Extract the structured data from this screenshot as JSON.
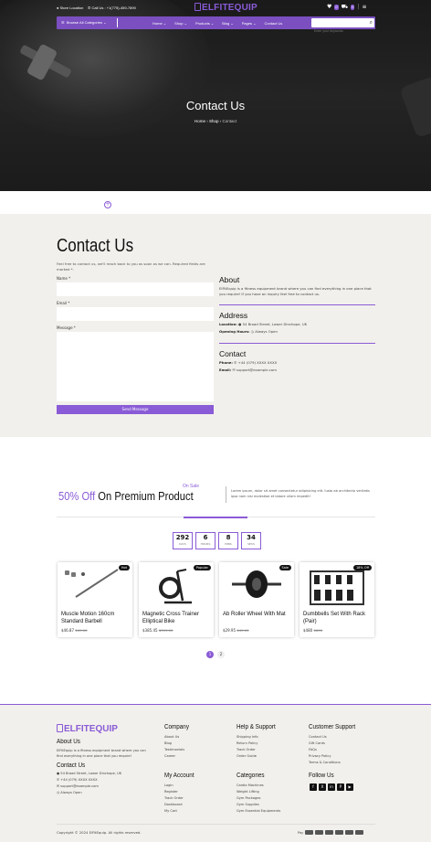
{
  "brand": {
    "name": "ELFITEQUIP",
    "accent": "#8a5bd6",
    "nav_bg": "#7b4fc0"
  },
  "topbar": {
    "store": "Store Location",
    "call": "Call Us : +1(775)-459-7890",
    "wishlist_count": "0",
    "cart_count": "0"
  },
  "nav": {
    "categories": "Browse All Categories",
    "items": [
      "Home",
      "Shop",
      "Products",
      "Blog",
      "Pages",
      "Contact Us"
    ],
    "search_placeholder": "Enter your keywords"
  },
  "hero": {
    "title": "Contact Us",
    "crumb_home": "Home",
    "crumb_shop": "Shop",
    "crumb_current": "Contact"
  },
  "contact": {
    "title": "Contact Us",
    "intro": "Feel free to contact us, we'll reach back to you as soon as we can. Required fields are marked *.",
    "name_label": "Name *",
    "email_label": "Email *",
    "message_label": "Message *",
    "send": "Send Message",
    "about_title": "About",
    "about_text": "ElFitEquip is a fitness equipment brand where you can find everything in one place that you require! If you have an inquiry feel free to contact us.",
    "address_title": "Address",
    "location_label": "Location:",
    "location_value": "54 Broad Street, Lower Dinchope, UK",
    "hours_label": "Opening Hours:",
    "hours_value": "Always Open",
    "contact_title": "Contact",
    "phone_label": "Phone:",
    "phone_value": "+44 (079) XXXX XXXX",
    "email_info_label": "Email:",
    "email_value": "support@example.com"
  },
  "offer": {
    "pct": "50% Off",
    "rest": "On Premium Product",
    "onsale": "On Sale",
    "text": "Lorem ipsum, dolor sit amet consectetur adipisicing elit. Iusto ab architecto veritatis ipsa nam nisi molestiae et labore ullam impedit!",
    "countdown": [
      {
        "n": "292",
        "l": "DAYS"
      },
      {
        "n": "6",
        "l": "HOURS"
      },
      {
        "n": "8",
        "l": "MINS"
      },
      {
        "n": "34",
        "l": "SECS"
      }
    ]
  },
  "products": [
    {
      "name": "Muscle Motion 160cm Standard Barbell",
      "price": "$46.87",
      "old": "$49.00",
      "tag": "Hot"
    },
    {
      "name": "Magnetic Cross Trainer Elliptical Bike",
      "price": "$385.45",
      "old": "$399.00",
      "tag": "Popular"
    },
    {
      "name": "Ab Roller Wheel With Mat",
      "price": "$29.95",
      "old": "$49.00",
      "tag": "Sale"
    },
    {
      "name": "Dumbbells Set With Rack (Pair)",
      "price": "$480",
      "old": "$600",
      "tag": "18% Off"
    }
  ],
  "pagination": [
    "1",
    "2"
  ],
  "footer": {
    "about_title": "About Us",
    "about_text": "ElFitEquip is a fitness equipment brand where you can find everything in one place that you require!",
    "contact_title": "Contact Us",
    "contact_lines": [
      "54 Broad Street, Lower Dinchope, UK",
      "+44 (079) XXXX XXXX",
      "support@example.com",
      "Always Open"
    ],
    "company_title": "Company",
    "company": [
      "About Us",
      "Blog",
      "Testimonials",
      "Career"
    ],
    "help_title": "Help & Support",
    "help": [
      "Shipping Info",
      "Return Policy",
      "Track Order",
      "Order Guide"
    ],
    "cs_title": "Customer Support",
    "cs": [
      "Contact Us",
      "Gift Cards",
      "FAQs",
      "Privacy Policy",
      "Terms & Conditions"
    ],
    "account_title": "My Account",
    "account": [
      "Login",
      "Register",
      "Track Order",
      "Dashboard",
      "My Cart"
    ],
    "cat_title": "Categories",
    "cats": [
      "Cardio Machines",
      "Weight Lifting",
      "Gym Packages",
      "Gym Supplies",
      "Gym Essential Equipments"
    ],
    "follow_title": "Follow Us",
    "social": [
      "f",
      "X",
      "in",
      "P",
      "▶"
    ],
    "copyright": "Copyright © 2024 ElFitEquip. All rights reserved.",
    "pay_label": "Pay"
  }
}
